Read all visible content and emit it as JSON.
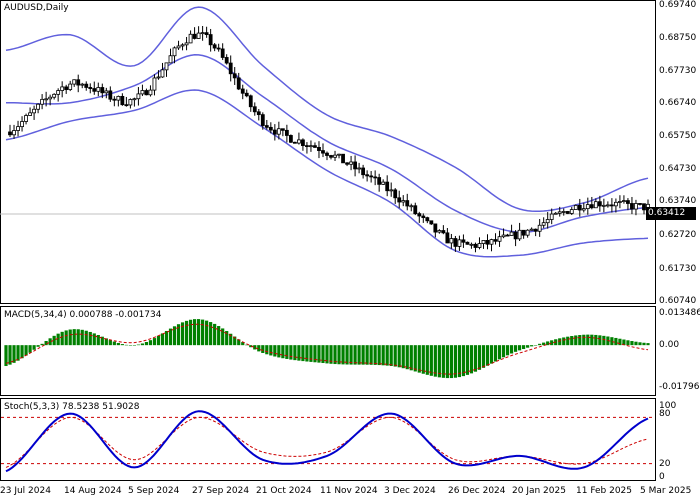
{
  "symbol_label": "AUDUSD,Daily",
  "current_price": "0.63412",
  "price_axis_labels": [
    "0.69740",
    "0.68750",
    "0.67730",
    "0.66740",
    "0.65750",
    "0.64730",
    "0.63740",
    "0.62720",
    "0.61730",
    "0.60740"
  ],
  "macd_label": "MACD(5,34,4) 0.000788 -0.001734",
  "macd_axis_labels": [
    "0.013486",
    "0.00",
    "-0.017968"
  ],
  "stoch_label": "Stoch(5,3,3) 78.5238 51.9028",
  "stoch_axis_labels": [
    "100",
    "80",
    "20",
    "0"
  ],
  "date_labels": [
    "23 Jul 2024",
    "14 Aug 2024",
    "5 Sep 2024",
    "27 Sep 2024",
    "21 Oct 2024",
    "11 Nov 2024",
    "3 Dec 2024",
    "26 Dec 2024",
    "20 Jan 2025",
    "11 Feb 2025",
    "5 Mar 2025"
  ],
  "colors": {
    "band": "#6060dd",
    "candle": "#000000",
    "macd_hist": "#008000",
    "macd_signal": "#cc0000",
    "stoch_main": "#0000cc",
    "stoch_signal": "#cc0000",
    "level_line": "#cc0000",
    "grid": "#c0c0c0"
  },
  "chart_data": [
    {
      "type": "candlestick",
      "title": "AUDUSD,Daily",
      "ylim": [
        0.604,
        0.7
      ],
      "x": [
        "23 Jul 2024",
        "14 Aug 2024",
        "5 Sep 2024",
        "27 Sep 2024",
        "21 Oct 2024",
        "11 Nov 2024",
        "3 Dec 2024",
        "26 Dec 2024",
        "20 Jan 2025",
        "11 Feb 2025",
        "5 Mar 2025"
      ],
      "close": [
        0.6585,
        0.674,
        0.669,
        0.69,
        0.662,
        0.652,
        0.639,
        0.6225,
        0.6255,
        0.635,
        0.6341
      ],
      "upper_band": [
        0.685,
        0.69,
        0.68,
        0.699,
        0.68,
        0.664,
        0.657,
        0.647,
        0.6335,
        0.6355,
        0.6435
      ],
      "middle_band": [
        0.668,
        0.668,
        0.6735,
        0.6835,
        0.67,
        0.6555,
        0.6465,
        0.633,
        0.626,
        0.631,
        0.634
      ],
      "lower_band": [
        0.656,
        0.662,
        0.6655,
        0.672,
        0.66,
        0.646,
        0.6355,
        0.62,
        0.6185,
        0.6225,
        0.624
      ]
    },
    {
      "type": "bar",
      "title": "MACD(5,34,4)",
      "ylim": [
        -0.017968,
        0.013486
      ],
      "x": [
        "23 Jul 2024",
        "14 Aug 2024",
        "5 Sep 2024",
        "27 Sep 2024",
        "21 Oct 2024",
        "11 Nov 2024",
        "3 Dec 2024",
        "26 Dec 2024",
        "20 Jan 2025",
        "11 Feb 2025",
        "5 Mar 2025"
      ],
      "series": [
        {
          "name": "MACD",
          "values": [
            -0.008,
            0.006,
            0.0,
            0.01,
            -0.003,
            -0.007,
            -0.008,
            -0.0125,
            -0.002,
            0.004,
            0.000788
          ]
        },
        {
          "name": "Signal",
          "values": [
            -0.007,
            0.004,
            0.001,
            0.008,
            -0.002,
            -0.006,
            -0.0075,
            -0.011,
            -0.003,
            0.003,
            -0.001734
          ]
        }
      ]
    },
    {
      "type": "line",
      "title": "Stoch(5,3,3)",
      "ylim": [
        0,
        100
      ],
      "levels": [
        20,
        80
      ],
      "x": [
        "23 Jul 2024",
        "14 Aug 2024",
        "5 Sep 2024",
        "27 Sep 2024",
        "21 Oct 2024",
        "11 Nov 2024",
        "3 Dec 2024",
        "26 Dec 2024",
        "20 Jan 2025",
        "11 Feb 2025",
        "5 Mar 2025"
      ],
      "series": [
        {
          "name": "Main",
          "values": [
            10,
            85,
            15,
            88,
            25,
            30,
            85,
            20,
            30,
            15,
            78.5238
          ]
        },
        {
          "name": "Signal",
          "values": [
            15,
            80,
            25,
            80,
            35,
            35,
            80,
            25,
            30,
            20,
            51.9028
          ]
        }
      ]
    }
  ]
}
